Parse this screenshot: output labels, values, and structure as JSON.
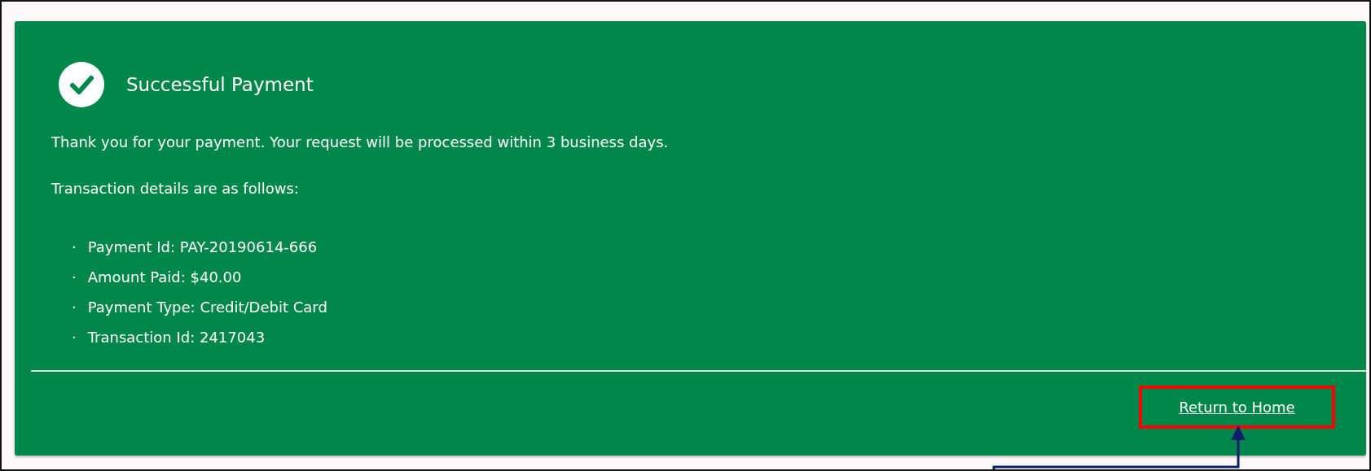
{
  "card": {
    "title": "Successful Payment",
    "message": "Thank you for your payment. Your request will be processed within 3 business days.",
    "details_intro": "Transaction details are as follows:",
    "details": [
      {
        "bullet": "·",
        "text": "Payment Id: PAY-20190614-666"
      },
      {
        "bullet": "·",
        "text": "Amount Paid: $40.00"
      },
      {
        "bullet": "·",
        "text": "Payment Type: Credit/Debit Card"
      },
      {
        "bullet": "·",
        "text": "Transaction Id: 2417043"
      }
    ],
    "link": "Return to Home"
  }
}
